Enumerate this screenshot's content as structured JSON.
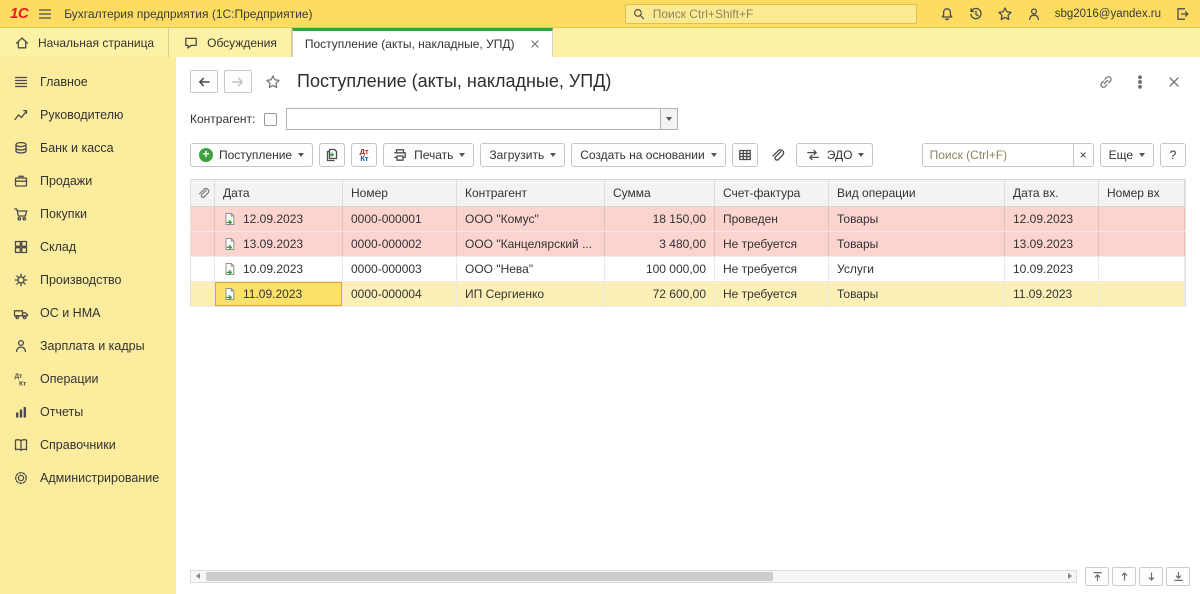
{
  "colors": {
    "topbar_yellow": "#fcdd61",
    "tabbar_yellow": "#fdf1a5",
    "sidebar_yellow": "#fcec9e",
    "accent_green": "#3ea03e",
    "brand_red": "#e31e24",
    "row_pink": "#fbd3cf",
    "row_selected": "#fdf0b6",
    "cell_selected": "#fbe06a",
    "cell_selected_border": "#d8a43c"
  },
  "topbar": {
    "logo": "1С",
    "app_title": "Бухгалтерия предприятия  (1С:Предприятие)",
    "search_placeholder": "Поиск Ctrl+Shift+F",
    "user_email": "sbg2016@yandex.ru"
  },
  "tabs": {
    "home": "Начальная страница",
    "discussions": "Обсуждения",
    "active": "Поступление (акты, накладные, УПД)"
  },
  "sidebar": {
    "items": [
      {
        "label": "Главное"
      },
      {
        "label": "Руководителю"
      },
      {
        "label": "Банк и касса"
      },
      {
        "label": "Продажи"
      },
      {
        "label": "Покупки"
      },
      {
        "label": "Склад"
      },
      {
        "label": "Производство"
      },
      {
        "label": "ОС и НМА"
      },
      {
        "label": "Зарплата и кадры"
      },
      {
        "label": "Операции"
      },
      {
        "label": "Отчеты"
      },
      {
        "label": "Справочники"
      },
      {
        "label": "Администрирование"
      }
    ]
  },
  "page": {
    "title": "Поступление (акты, накладные, УПД)",
    "filter": {
      "label": "Контрагент:",
      "value": ""
    },
    "toolbar": {
      "create": "Поступление",
      "print": "Печать",
      "load": "Загрузить",
      "create_based": "Создать на основании",
      "edo": "ЭДО",
      "search_placeholder": "Поиск (Ctrl+F)",
      "clear": "×",
      "more": "Еще",
      "help": "?"
    },
    "table": {
      "columns": [
        "Дата",
        "Номер",
        "Контрагент",
        "Сумма",
        "Счет-фактура",
        "Вид операции",
        "Дата вх.",
        "Номер вх"
      ],
      "rows": [
        {
          "date": "12.09.2023",
          "number": "0000-000001",
          "contragent": "ООО \"Комус\"",
          "sum": "18 150,00",
          "invoice": "Проведен",
          "operation": "Товары",
          "date_in": "12.09.2023",
          "number_in": "",
          "highlight": "pink"
        },
        {
          "date": "13.09.2023",
          "number": "0000-000002",
          "contragent": "ООО \"Канцелярский ...",
          "sum": "3 480,00",
          "invoice": "Не требуется",
          "operation": "Товары",
          "date_in": "13.09.2023",
          "number_in": "",
          "highlight": "pink"
        },
        {
          "date": "10.09.2023",
          "number": "0000-000003",
          "contragent": "ООО \"Нева\"",
          "sum": "100 000,00",
          "invoice": "Не требуется",
          "operation": "Услуги",
          "date_in": "10.09.2023",
          "number_in": "",
          "highlight": "none"
        },
        {
          "date": "11.09.2023",
          "number": "0000-000004",
          "contragent": "ИП Сергиенко",
          "sum": "72 600,00",
          "invoice": "Не требуется",
          "operation": "Товары",
          "date_in": "11.09.2023",
          "number_in": "",
          "highlight": "selected"
        }
      ]
    }
  }
}
